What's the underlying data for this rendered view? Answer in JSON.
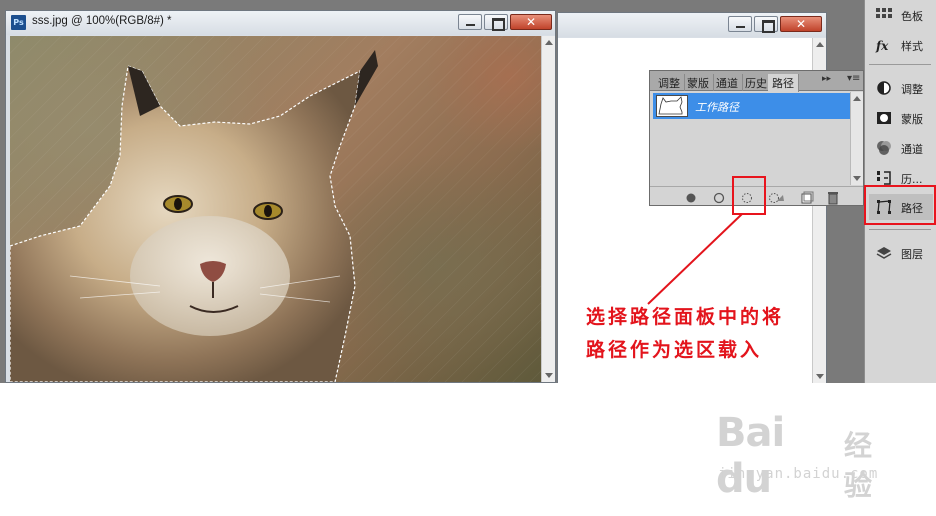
{
  "document": {
    "title": "sss.jpg @ 100%(RGB/8#) *",
    "ps_badge": "Ps",
    "close_symbol": "✕"
  },
  "paths_panel": {
    "tabs": [
      "调整",
      "蒙版",
      "通道",
      "历史",
      "路径"
    ],
    "active_tab": "路径",
    "path_name": "工作路径",
    "bottom_buttons": [
      "fill-path-icon",
      "stroke-path-icon",
      "load-path-as-selection-icon",
      "make-work-path-icon",
      "new-path-icon",
      "delete-path-icon"
    ],
    "arrows": "▸▸",
    "menu": "▾≡"
  },
  "dock": {
    "items": [
      {
        "label": "色板",
        "icon": "swatches-icon"
      },
      {
        "label": "样式",
        "icon": "styles-icon"
      },
      {
        "label": "调整",
        "icon": "adjustments-icon"
      },
      {
        "label": "蒙版",
        "icon": "masks-icon"
      },
      {
        "label": "通道",
        "icon": "channels-icon"
      },
      {
        "label": "历...",
        "icon": "history-icon"
      },
      {
        "label": "路径",
        "icon": "paths-icon"
      },
      {
        "label": "图层",
        "icon": "layers-icon"
      }
    ],
    "selected": "路径"
  },
  "annotation": {
    "line1": "选择路径面板中的将",
    "line2": "路径作为选区载入",
    "color": "#e3141c"
  },
  "watermark": {
    "brand": "Bai du",
    "cn": "经验",
    "url": "jingyan.baidu.com"
  }
}
